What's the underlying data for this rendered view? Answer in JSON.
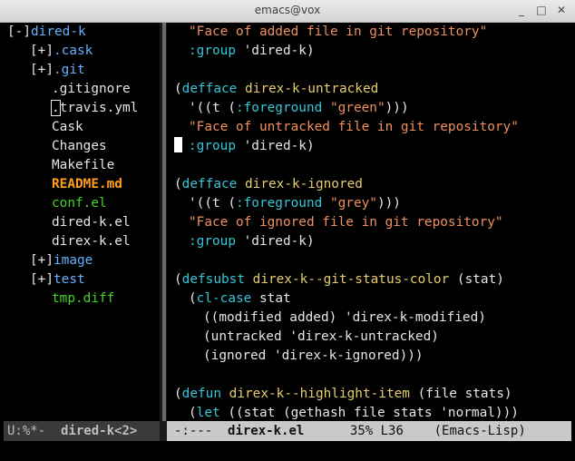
{
  "window": {
    "title": "emacs@vox",
    "minimize": "_",
    "maximize": "□",
    "close": "✕"
  },
  "tree": {
    "root_toggle": "[-]",
    "root_name": "dired-k",
    "items": [
      {
        "toggle": "[+]",
        "name": ".cask"
      },
      {
        "toggle": "[+]",
        "name": ".git"
      },
      {
        "name": ".gitignore"
      },
      {
        "cursor_char": ".",
        "name": "travis.yml"
      },
      {
        "name": "Cask"
      },
      {
        "name": "Changes"
      },
      {
        "name": "Makefile"
      },
      {
        "name": "README.md"
      },
      {
        "name": "conf.el"
      },
      {
        "name": "dired-k.el"
      },
      {
        "name": "direx-k.el"
      },
      {
        "toggle": "[+]",
        "name": "image"
      },
      {
        "toggle": "[+]",
        "name": "test"
      },
      {
        "name": "tmp.diff"
      }
    ]
  },
  "code": {
    "l1": {
      "str": "\"Face of added file in git repository\""
    },
    "l2": {
      "kw": ":group",
      "rest": " 'dired-k)"
    },
    "l4": {
      "open": "(",
      "kw": "defface",
      "sp": " ",
      "name": "direx-k-untracked"
    },
    "l5": {
      "a": "'((t (",
      "kw": ":foreground",
      "sp": " ",
      "str": "\"green\"",
      "b": ")))"
    },
    "l6": {
      "str": "\"Face of untracked file in git repository\""
    },
    "l7": {
      "kw": ":group",
      "rest": " 'dired-k)"
    },
    "l9": {
      "open": "(",
      "kw": "defface",
      "sp": " ",
      "name": "direx-k-ignored"
    },
    "l10": {
      "a": "'((t (",
      "kw": ":foreground",
      "sp": " ",
      "str": "\"grey\"",
      "b": ")))"
    },
    "l11": {
      "str": "\"Face of ignored file in git repository\""
    },
    "l12": {
      "kw": ":group",
      "rest": " 'dired-k)"
    },
    "l14": {
      "open": "(",
      "kw": "defsubst",
      "sp": " ",
      "name": "direx-k--git-status-color",
      "rest": " (stat)"
    },
    "l15": {
      "open": "(",
      "kw": "cl-case",
      "rest": " stat"
    },
    "l16": {
      "text": "((modified added) 'direx-k-modified)"
    },
    "l17": {
      "text": "(untracked 'direx-k-untracked)"
    },
    "l18": {
      "text": "(ignored 'direx-k-ignored)))"
    },
    "l20": {
      "open": "(",
      "kw": "defun",
      "sp": " ",
      "name": "direx-k--highlight-item",
      "rest": " (file stats)"
    },
    "l21": {
      "open": "(",
      "kw": "let",
      "rest": " ((stat (gethash file stats 'normal)))"
    }
  },
  "modeline_left": {
    "state": "U:%*-",
    "buffer": "dired-k<2>"
  },
  "modeline_right": {
    "state": "-:---",
    "buffer": "direx-k.el",
    "position": "35% L36",
    "mode": "(Emacs-Lisp)"
  }
}
